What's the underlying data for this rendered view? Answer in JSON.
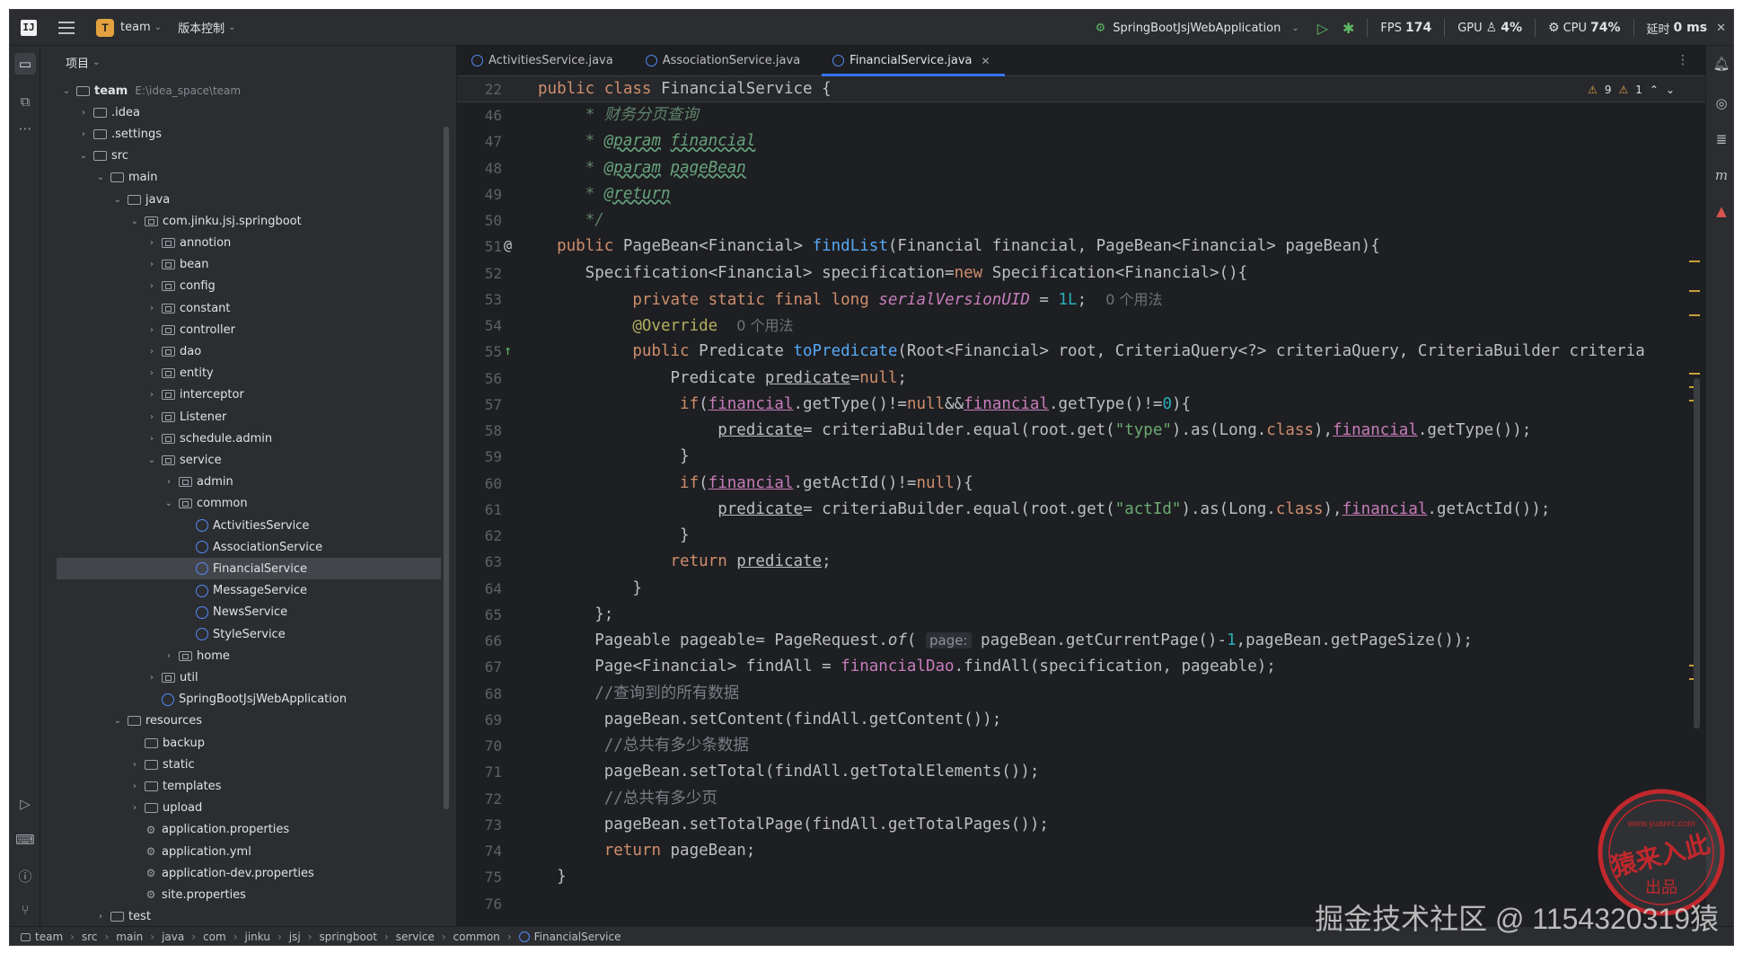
{
  "titlebar": {
    "app_logo": "IJ",
    "project_badge": "T",
    "project_name": "team",
    "vcs_label": "版本控制",
    "run_config": "SpringBootJsjWebApplication",
    "fps_label": "FPS",
    "fps_value": "174",
    "gpu_label": "GPU",
    "gpu_value": "4%",
    "cpu_label": "CPU",
    "cpu_value": "74%",
    "latency_label": "延时",
    "latency_value": "0 ms"
  },
  "project_panel": {
    "title": "项目",
    "tree": [
      {
        "depth": 0,
        "label": "team",
        "path": "E:\\idea_space\\team",
        "kind": "module",
        "open": true,
        "bold": true
      },
      {
        "depth": 1,
        "label": ".idea",
        "kind": "folder",
        "open": false
      },
      {
        "depth": 1,
        "label": ".settings",
        "kind": "folder",
        "open": false
      },
      {
        "depth": 1,
        "label": "src",
        "kind": "folder",
        "open": true
      },
      {
        "depth": 2,
        "label": "main",
        "kind": "folder",
        "open": true
      },
      {
        "depth": 3,
        "label": "java",
        "kind": "folder",
        "open": true
      },
      {
        "depth": 4,
        "label": "com.jinku.jsj.springboot",
        "kind": "package",
        "open": true
      },
      {
        "depth": 5,
        "label": "annotion",
        "kind": "package",
        "open": false
      },
      {
        "depth": 5,
        "label": "bean",
        "kind": "package",
        "open": false
      },
      {
        "depth": 5,
        "label": "config",
        "kind": "package",
        "open": false
      },
      {
        "depth": 5,
        "label": "constant",
        "kind": "package",
        "open": false
      },
      {
        "depth": 5,
        "label": "controller",
        "kind": "package",
        "open": false
      },
      {
        "depth": 5,
        "label": "dao",
        "kind": "package",
        "open": false
      },
      {
        "depth": 5,
        "label": "entity",
        "kind": "package",
        "open": false
      },
      {
        "depth": 5,
        "label": "interceptor",
        "kind": "package",
        "open": false
      },
      {
        "depth": 5,
        "label": "Listener",
        "kind": "package",
        "open": false
      },
      {
        "depth": 5,
        "label": "schedule.admin",
        "kind": "package",
        "open": false
      },
      {
        "depth": 5,
        "label": "service",
        "kind": "package",
        "open": true
      },
      {
        "depth": 6,
        "label": "admin",
        "kind": "package",
        "open": false
      },
      {
        "depth": 6,
        "label": "common",
        "kind": "package",
        "open": true
      },
      {
        "depth": 7,
        "label": "ActivitiesService",
        "kind": "class"
      },
      {
        "depth": 7,
        "label": "AssociationService",
        "kind": "class"
      },
      {
        "depth": 7,
        "label": "FinancialService",
        "kind": "class",
        "selected": true
      },
      {
        "depth": 7,
        "label": "MessageService",
        "kind": "class"
      },
      {
        "depth": 7,
        "label": "NewsService",
        "kind": "class"
      },
      {
        "depth": 7,
        "label": "StyleService",
        "kind": "class"
      },
      {
        "depth": 6,
        "label": "home",
        "kind": "package",
        "open": false
      },
      {
        "depth": 5,
        "label": "util",
        "kind": "package",
        "open": false
      },
      {
        "depth": 5,
        "label": "SpringBootJsjWebApplication",
        "kind": "class"
      },
      {
        "depth": 3,
        "label": "resources",
        "kind": "folder",
        "open": true
      },
      {
        "depth": 4,
        "label": "backup",
        "kind": "folder",
        "leaf": true
      },
      {
        "depth": 4,
        "label": "static",
        "kind": "folder",
        "open": false
      },
      {
        "depth": 4,
        "label": "templates",
        "kind": "folder",
        "open": false
      },
      {
        "depth": 4,
        "label": "upload",
        "kind": "folder",
        "open": false
      },
      {
        "depth": 4,
        "label": "application.properties",
        "kind": "config"
      },
      {
        "depth": 4,
        "label": "application.yml",
        "kind": "config"
      },
      {
        "depth": 4,
        "label": "application-dev.properties",
        "kind": "config"
      },
      {
        "depth": 4,
        "label": "site.properties",
        "kind": "config"
      },
      {
        "depth": 2,
        "label": "test",
        "kind": "folder",
        "open": false
      }
    ]
  },
  "editor": {
    "tabs": [
      {
        "label": "ActivitiesService.java",
        "active": false
      },
      {
        "label": "AssociationService.java",
        "active": false
      },
      {
        "label": "FinancialService.java",
        "active": true
      }
    ],
    "inspection_warnings": "9",
    "inspection_weak": "1",
    "sticky_line": {
      "num": "22",
      "html": "<span class=\"k\">public class</span> FinancialService {"
    },
    "lines": [
      {
        "num": "46",
        "html": "    <span class=\"doc\"> * 财务分页查询</span>"
      },
      {
        "num": "47",
        "html": "    <span class=\"doc\"> * </span><span class=\"doctag\">@param</span><span class=\"doc\"> </span><span class=\"doctag\">financial</span>"
      },
      {
        "num": "48",
        "html": "    <span class=\"doc\"> * </span><span class=\"doctag\">@param</span><span class=\"doc\"> </span><span class=\"doctag\">pageBean</span>"
      },
      {
        "num": "49",
        "html": "    <span class=\"doc\"> * </span><span class=\"doctag\">@return</span>"
      },
      {
        "num": "50",
        "html": "    <span class=\"doc\"> */</span>"
      },
      {
        "num": "51",
        "html": "  <span class=\"k\">public</span> PageBean&lt;Financial&gt; <span class=\"fn\">findList</span>(Financial financial, PageBean&lt;Financial&gt; pageBean){",
        "mark": "@"
      },
      {
        "num": "52",
        "html": "     Specification&lt;Financial&gt; specification=<span class=\"k\">new</span> Specification&lt;Financial&gt;(){"
      },
      {
        "num": "53",
        "html": "          <span class=\"k\">private static final long</span> <span class=\"static\">serialVersionUID</span> = <span class=\"num\">1L</span>;  <span class=\"hint\">0 个用法</span>"
      },
      {
        "num": "54",
        "html": "          <span class=\"ann\">@Override</span>  <span class=\"hint\">0 个用法</span>"
      },
      {
        "num": "55",
        "html": "          <span class=\"k\">public</span> Predicate <span class=\"fn\">toPredicate</span>(Root&lt;Financial&gt; root, CriteriaQuery&lt;?&gt; criteriaQuery, CriteriaBuilder criteria",
        "mark": "↑"
      },
      {
        "num": "56",
        "html": "              Predicate <span class=\"ul\">predicate</span>=<span class=\"k\">null</span>;"
      },
      {
        "num": "57",
        "html": "               <span class=\"k\">if</span>(<span class=\"ulf\">financial</span>.getType()!=<span class=\"k\">null</span>&amp;&amp;<span class=\"ulf\">financial</span>.getType()!=<span class=\"num\">0</span>){"
      },
      {
        "num": "58",
        "html": "                   <span class=\"ul\">predicate</span>= criteriaBuilder.equal(root.get(<span class=\"str\">\"type\"</span>).as(Long.<span class=\"k\">class</span>),<span class=\"ulf\">financial</span>.getType());"
      },
      {
        "num": "59",
        "html": "               }"
      },
      {
        "num": "60",
        "html": "               <span class=\"k\">if</span>(<span class=\"ulf\">financial</span>.getActId()!=<span class=\"k\">null</span>){"
      },
      {
        "num": "61",
        "html": "                   <span class=\"ul\">predicate</span>= criteriaBuilder.equal(root.get(<span class=\"str\">\"actId\"</span>).as(Long.<span class=\"k\">class</span>),<span class=\"ulf\">financial</span>.getActId());"
      },
      {
        "num": "62",
        "html": "               }"
      },
      {
        "num": "63",
        "html": "              <span class=\"k\">return</span> <span class=\"ul\">predicate</span>;"
      },
      {
        "num": "64",
        "html": "          }"
      },
      {
        "num": "65",
        "html": "      };"
      },
      {
        "num": "66",
        "html": "      Pageable pageable= PageRequest.<i>of</i>( <span class=\"param-hint\">page:</span> pageBean.getCurrentPage()-<span class=\"num\">1</span>,pageBean.getPageSize());"
      },
      {
        "num": "67",
        "html": "      Page&lt;Financial&gt; findAll = <span class=\"field\">financialDao</span>.findAll(specification, pageable);"
      },
      {
        "num": "68",
        "html": "      <span class=\"cmt\">//查询到的所有数据</span>"
      },
      {
        "num": "69",
        "html": "       pageBean.setContent(findAll.getContent());"
      },
      {
        "num": "70",
        "html": "       <span class=\"cmt\">//总共有多少条数据</span>"
      },
      {
        "num": "71",
        "html": "       pageBean.setTotal(findAll.getTotalElements());"
      },
      {
        "num": "72",
        "html": "       <span class=\"cmt\">//总共有多少页</span>"
      },
      {
        "num": "73",
        "html": "       pageBean.setTotalPage(findAll.getTotalPages());"
      },
      {
        "num": "74",
        "html": "       <span class=\"k\">return</span> pageBean;"
      },
      {
        "num": "75",
        "html": "  }"
      },
      {
        "num": "76",
        "html": ""
      }
    ]
  },
  "statusbar": {
    "breadcrumbs": [
      "team",
      "src",
      "main",
      "java",
      "com",
      "jinku",
      "jsj",
      "springboot",
      "service",
      "common",
      "FinancialService"
    ]
  },
  "watermark": {
    "text": "掘金技术社区 @ 1154320319猿",
    "seal_top": "www.yuanrc.com",
    "seal_main": "猿来入此",
    "seal_sub": "出品"
  },
  "colors": {
    "accent": "#3574f0",
    "keyword": "#cf8e6d",
    "function": "#56a8f5",
    "string": "#6aab73",
    "number": "#2aacb8",
    "field": "#c77dbb",
    "seal_red": "#c0282d"
  }
}
